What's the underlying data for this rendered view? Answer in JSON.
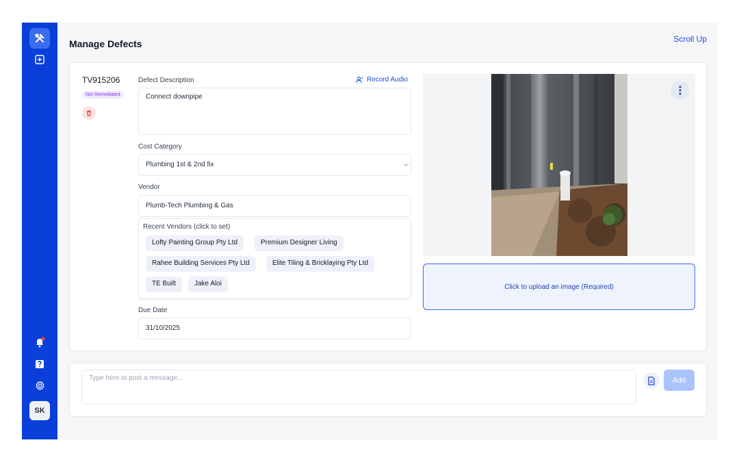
{
  "app": {
    "page_title": "Manage Defects",
    "scroll_up": "Scroll Up",
    "accent_color": "#0b3fd9"
  },
  "sidebar": {
    "items": [
      {
        "icon": "tools-icon"
      },
      {
        "icon": "plus-square-icon"
      },
      {
        "icon": "bell-icon",
        "has_notification": true
      },
      {
        "icon": "help-icon"
      },
      {
        "icon": "gear-icon"
      }
    ],
    "avatar_initials": "SK"
  },
  "defect": {
    "id": "TV915206",
    "status": "Not Remediated",
    "description_label": "Defect Description",
    "record_audio": "Record Audio",
    "description_value": "Connect downpipe",
    "cost_category_label": "Cost Category",
    "cost_category_value": "Plumbing 1st & 2nd fix",
    "vendor_label": "Vendor",
    "vendor_value": "Plumb-Tech Plumbing & Gas",
    "recent_vendors_label": "Recent Vendors (click to set)",
    "recent_vendors": [
      "Lofty Painting Group Pty Ltd",
      "Premium Designer Living",
      "Rahee Building Services Pty Ltd",
      "Elite Tiling & Bricklaying Pty Ltd",
      "TE Built",
      "Jake Aloi"
    ],
    "due_date_label": "Due Date",
    "due_date_value": "31/10/2025",
    "upload_label": "Click to upload an image (Required)"
  },
  "message": {
    "placeholder": "Type here to post a message...",
    "add_label": "Add"
  }
}
